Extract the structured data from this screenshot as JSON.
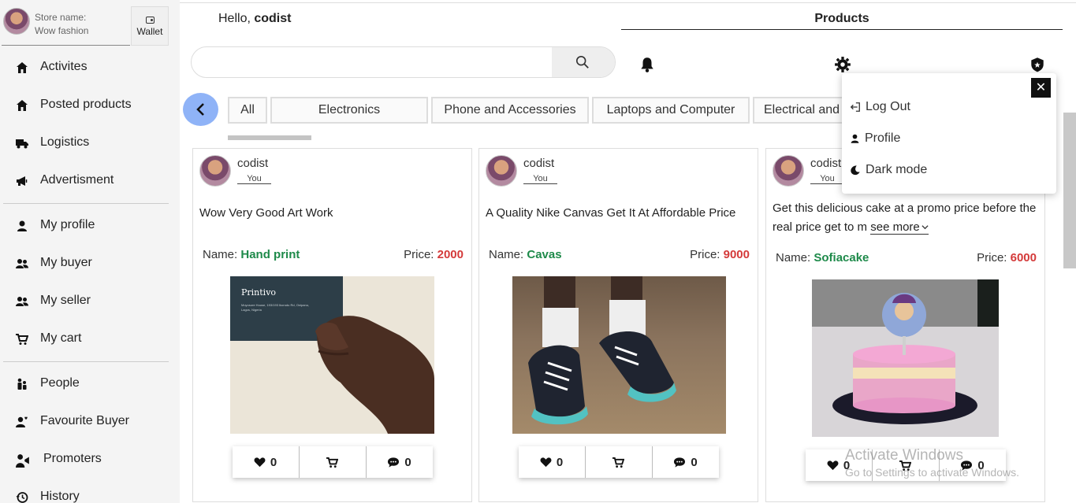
{
  "sidebar": {
    "store_label": "Store name:",
    "store_name": "Wow fashion",
    "wallet_label": "Wallet",
    "items": [
      {
        "label": "Activites",
        "icon": "home-icon"
      },
      {
        "label": "Posted products",
        "icon": "home-icon"
      },
      {
        "label": "Logistics",
        "icon": "truck-icon"
      },
      {
        "label": "Advertisment",
        "icon": "megaphone-icon"
      },
      {
        "label": "My profile",
        "icon": "user-icon"
      },
      {
        "label": "My buyer",
        "icon": "users-icon"
      },
      {
        "label": "My seller",
        "icon": "users-icon"
      },
      {
        "label": "My cart",
        "icon": "cart-icon"
      },
      {
        "label": "People",
        "icon": "people-icon"
      },
      {
        "label": "Favourite Buyer",
        "icon": "user-heart-icon"
      },
      {
        "label": "Promoters",
        "icon": "promoter-icon"
      },
      {
        "label": "History",
        "icon": "history-icon"
      }
    ]
  },
  "header": {
    "greeting": "Hello,",
    "username": "codist",
    "products_title": "Products"
  },
  "search": {
    "placeholder": "",
    "value": ""
  },
  "categories": [
    "All",
    "Electronics",
    "Phone and Accessories",
    "Laptops and Computer",
    "Electrical and E"
  ],
  "posts": [
    {
      "user": "codist",
      "you": "You",
      "description": "Wow Very Good Art Work",
      "name_label": "Name:",
      "name": "Hand print",
      "price_label": "Price:",
      "price": "2000",
      "card_text": "Printivo",
      "card_address": "Moyosore House, 193/193 Ikorodu Rd, Onipanu, Lagos, Nigeria",
      "likes": "0",
      "comments": "0"
    },
    {
      "user": "codist",
      "you": "You",
      "description": "A Quality Nike Canvas Get It At Affordable Price",
      "name_label": "Name:",
      "name": "Cavas",
      "price_label": "Price:",
      "price": "9000",
      "likes": "0",
      "comments": "0"
    },
    {
      "user": "codist",
      "you": "You",
      "description": "Get this delicious cake at a promo price before the real price get to m",
      "see_more": "see more",
      "name_label": "Name:",
      "name": "Sofiacake",
      "price_label": "Price:",
      "price": "6000",
      "likes": "0",
      "comments": "0"
    }
  ],
  "dropdown": {
    "close": "✕",
    "items": [
      {
        "label": "Log Out",
        "icon": "logout-icon"
      },
      {
        "label": "Profile",
        "icon": "user-icon"
      },
      {
        "label": "Dark mode",
        "icon": "moon-icon"
      }
    ]
  },
  "watermark": {
    "title": "Activate Windows",
    "subtitle": "Go to Settings to activate Windows."
  },
  "colors": {
    "name_green": "#1e8a4a",
    "price_red": "#d43a3a",
    "back_button_blue": "#8fb3f7",
    "sidebar_bg": "#f4f4f4"
  }
}
